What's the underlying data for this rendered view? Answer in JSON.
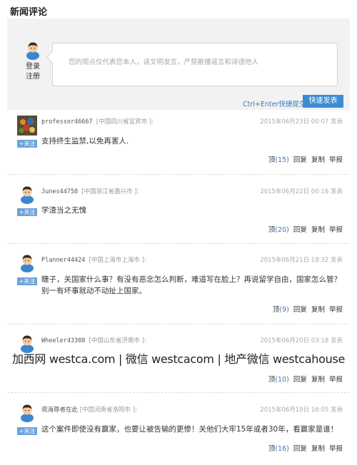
{
  "section_title": "新闻评论",
  "compose": {
    "login_label": "登录",
    "register_label": "注册",
    "placeholder": "您的观点仅代表您本人，请文明发言，严禁散播谣言和诽谤他人",
    "hint": "Ctrl+Enter快捷提交",
    "submit_label": "快速发表"
  },
  "follow_label": "+关注",
  "action_labels": {
    "top": "顶",
    "reply": "回复",
    "copy": "复制",
    "report": "举报"
  },
  "comments": [
    {
      "user": "professor46667",
      "location": "[中国四川省宜宾市 ]:",
      "time": "2015年06月23日 00:07 发表",
      "text": "支持终生监禁,以免再害人.",
      "top_count": "(15)"
    },
    {
      "user": "Junes44758",
      "location": "[中国浙江省嘉兴市 ]:",
      "time": "2015年06月22日 00:16 发表",
      "text": "学渣当之无愧",
      "top_count": "(20)"
    },
    {
      "user": "Planner44424",
      "location": "[中国上海市上海市 ]:",
      "time": "2015年06月21日 18:32 发表",
      "text": "睫子，关国家什么事？有没有恶念怎么判断，难道写在脸上？再说留学自由，国家怎么管？别一有坏事就动不动扯上国家。",
      "top_count": "(9)"
    },
    {
      "user": "Wheeler43308",
      "location": "[中国山东省济南市 ]:",
      "time": "2015年06月20日 03:18 发表",
      "text": "",
      "top_count": "(10)"
    },
    {
      "user": "观海尊者在此",
      "location": "[中国河南省洛阳市 ]:",
      "time": "2015年06月19日 16:05 发表",
      "text": "这个案件即使没有赢家，也要让被告输的更惨！关他们大牢15年或者30年，看赢家是谁！",
      "top_count": "(16)"
    }
  ],
  "watermark": "加西网 westca.com | 微信 westcacom | 地产微信 westcahouse"
}
